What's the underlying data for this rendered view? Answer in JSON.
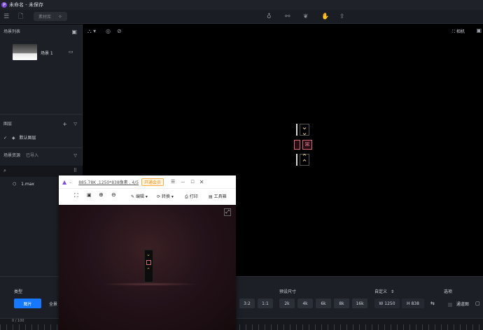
{
  "app": {
    "title": "未命名 - 未保存",
    "logo_glyph": "P"
  },
  "toolbar": {
    "search_label": "素材库"
  },
  "left": {
    "scene_list_title": "场景列表",
    "scene_item": "场景 1",
    "layers_title": "图层",
    "default_layer": "默认图层",
    "assets_title": "场景资源",
    "assets_imported": "已导入",
    "asset_file": "1.max"
  },
  "viewport": {
    "camera_label": "相机"
  },
  "bottom": {
    "type_label": "类型",
    "type_btn_image": "图片",
    "type_btn_panorama": "全景",
    "ratio_3_2": "3:2",
    "ratio_1_1": "1:1",
    "preset_size_label": "预设尺寸",
    "size_2k": "2k",
    "size_4k": "4k",
    "size_6k": "6k",
    "size_8k": "8k",
    "size_16k": "16k",
    "custom_label": "自定义",
    "width_prefix": "W",
    "width_value": "1250",
    "height_prefix": "H",
    "height_value": "838",
    "options_label": "选项",
    "option_channel": "通道图",
    "timeline_text": "0 / 100"
  },
  "viewer": {
    "info": "885.78K ,1250*838像素 , 4/5",
    "vip_badge": "开通会员",
    "edit_label": "编辑",
    "convert_label": "转换",
    "print_label": "打印",
    "toolbox_label": "工具箱"
  },
  "sign": {
    "red_glyph": "ꕤ"
  },
  "colors": {
    "accent": "#1677ff",
    "background": "#000000",
    "panel": "#1c1f25"
  }
}
